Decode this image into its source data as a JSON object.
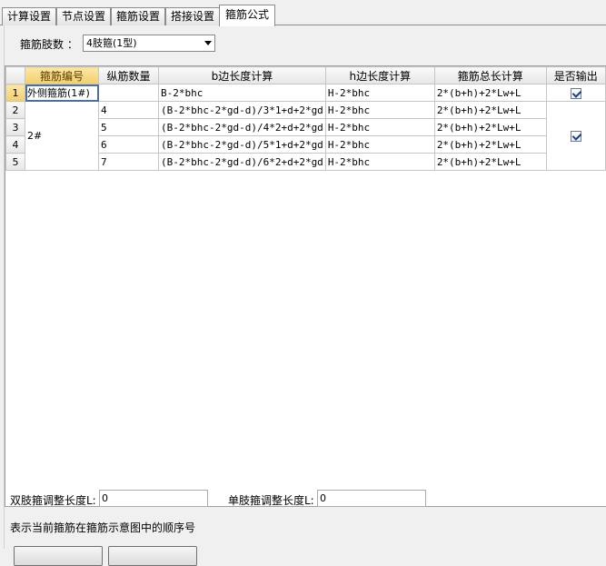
{
  "tabs": [
    {
      "label": "计算设置"
    },
    {
      "label": "节点设置"
    },
    {
      "label": "箍筋设置"
    },
    {
      "label": "搭接设置"
    },
    {
      "label": "箍筋公式"
    }
  ],
  "stirrup_legs": {
    "label": "箍筋肢数 ：",
    "value": "4肢箍(1型)"
  },
  "table": {
    "headers": [
      "箍筋编号",
      "纵筋数量",
      "b边长度计算",
      "h边长度计算",
      "箍筋总长计算",
      "是否输出"
    ],
    "row_numbers": [
      "1",
      "2",
      "3",
      "4",
      "5"
    ],
    "rows": [
      {
        "id": "外侧箍筋(1#)",
        "count": "",
        "b": "B-2*bhc",
        "h": "H-2*bhc",
        "total": "2*(b+h)+2*Lw+L"
      },
      {
        "id": "2#",
        "count": "4",
        "b": "(B-2*bhc-2*gd-d)/3*1+d+2*gd",
        "h": "H-2*bhc",
        "total": "2*(b+h)+2*Lw+L"
      },
      {
        "id": "",
        "count": "5",
        "b": "(B-2*bhc-2*gd-d)/4*2+d+2*gd",
        "h": "H-2*bhc",
        "total": "2*(b+h)+2*Lw+L"
      },
      {
        "id": "",
        "count": "6",
        "b": "(B-2*bhc-2*gd-d)/5*1+d+2*gd",
        "h": "H-2*bhc",
        "total": "2*(b+h)+2*Lw+L"
      },
      {
        "id": "",
        "count": "7",
        "b": "(B-2*bhc-2*gd-d)/6*2+d+2*gd",
        "h": "H-2*bhc",
        "total": "2*(b+h)+2*Lw+L"
      }
    ],
    "output_checked": [
      true,
      true
    ]
  },
  "adjust": {
    "double_label": "双肢箍调整长度L:",
    "double_value": "0",
    "single_label": "单肢箍调整长度L:",
    "single_value": "0"
  },
  "hint": "表示当前箍筋在箍筋示意图中的顺序号"
}
